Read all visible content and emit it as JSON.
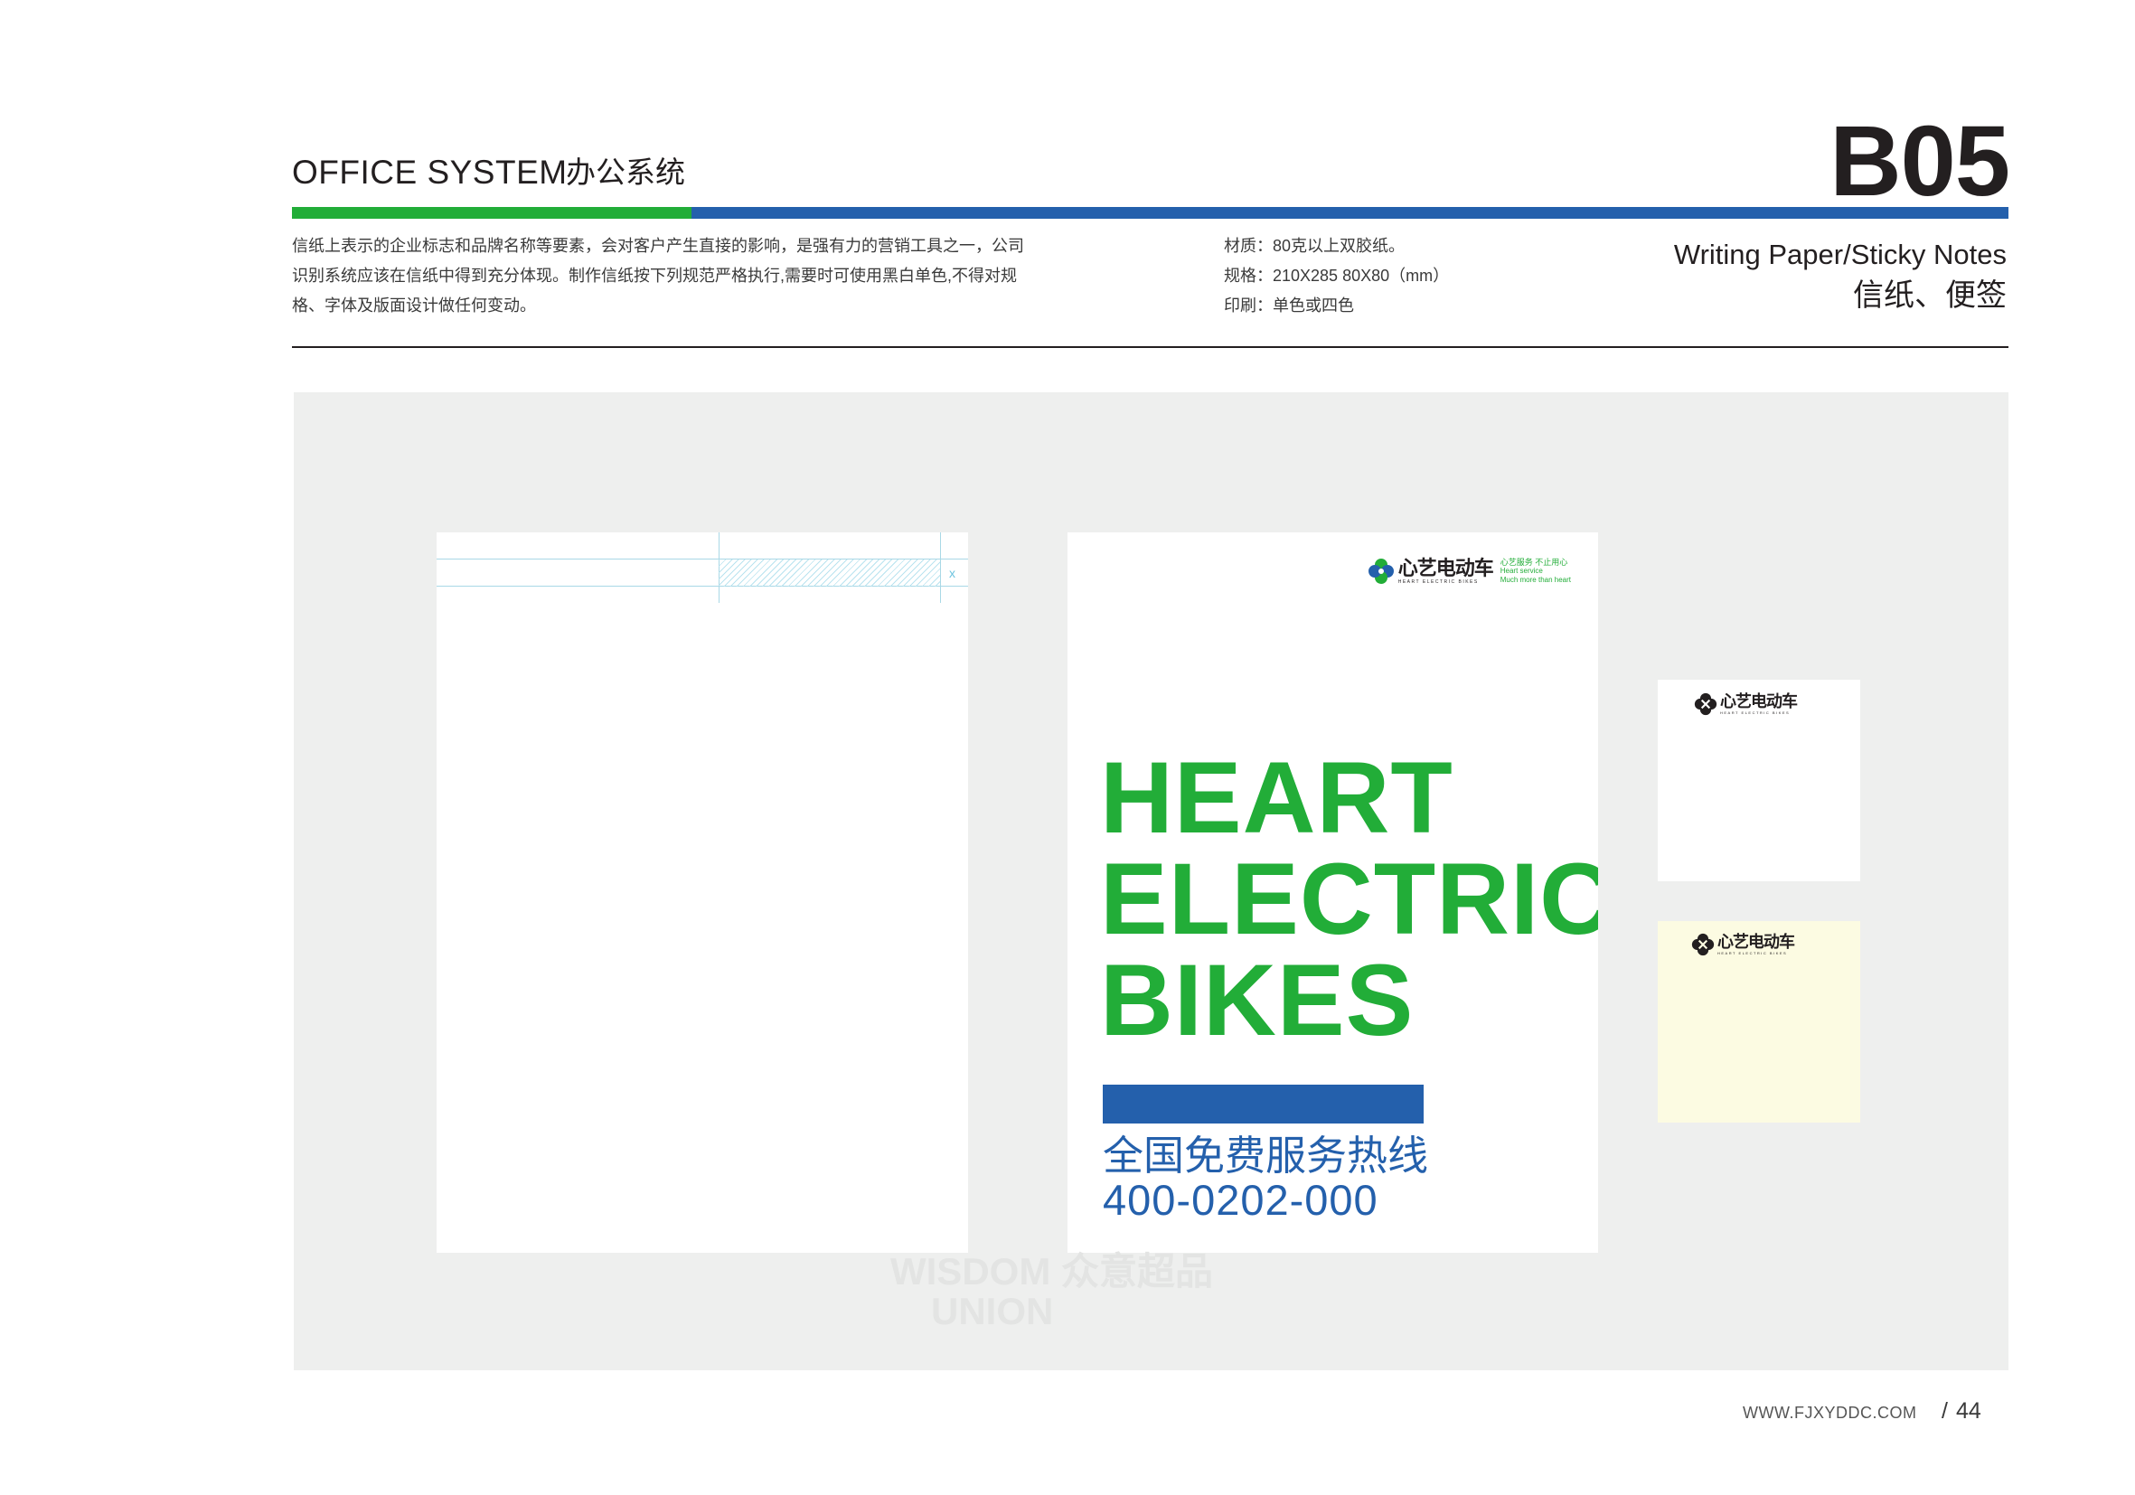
{
  "header": {
    "section_en": "OFFICE SYSTEM",
    "section_cn": "办公系统",
    "page_code": "B05",
    "title_en": "Writing Paper/Sticky Notes",
    "title_cn": "信纸、便签",
    "description_lines": [
      "信纸上表示的企业标志和品牌名称等要素，会对客户产生直接的影响，是强有力的营销工具之一，公司",
      "识别系统应该在信纸中得到充分体现。制作信纸按下列规范严格执行,需要时可使用黑白单色,不得对规",
      "格、字体及版面设计做任何变动。"
    ],
    "spec_lines": [
      "材质：80克以上双胶纸。",
      "规格：210X285  80X80（mm）",
      "印刷：单色或四色"
    ]
  },
  "colors": {
    "brand_green": "#22ad38",
    "brand_blue": "#2460ac",
    "panel_gray": "#eeefee",
    "note_cream": "#fcfbe2"
  },
  "logo": {
    "name_cn": "心艺电动车",
    "name_en": "HEART ELECTRIC BIKES",
    "slogan_cn": "心艺服务 不止用心",
    "slogan_en_1": "Heart service",
    "slogan_en_2": "Much more than heart",
    "mark_icon": "four-petal-clover-icon"
  },
  "blank_paper": {
    "guide_marker": "x"
  },
  "cover": {
    "headline": [
      "HEART",
      "ELECTRIC",
      "BIKES"
    ],
    "hotline_label": "全国免费服务热线",
    "hotline_number": "400-0202-000"
  },
  "watermark": {
    "line1": "WISDOM 众意超品",
    "line2": "UNION"
  },
  "footer": {
    "url": "WWW.FJXYDDC.COM",
    "slash": "/",
    "page_number": "44"
  }
}
